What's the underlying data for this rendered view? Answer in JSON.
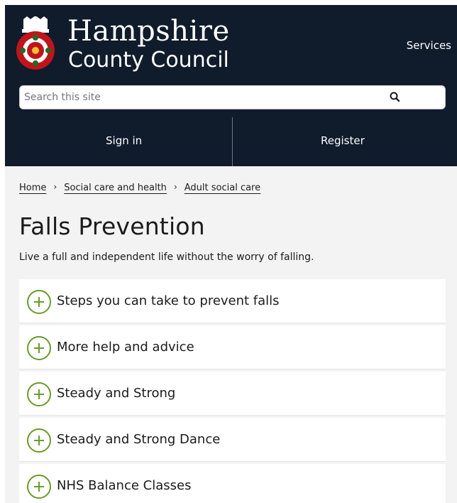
{
  "header": {
    "brand_line1": "Hampshire",
    "brand_line2": "County Council",
    "services_label": "Services",
    "background_color": "#101b2c"
  },
  "search": {
    "placeholder": "Search this site",
    "icon": "search-icon"
  },
  "auth": {
    "sign_in_label": "Sign in",
    "register_label": "Register"
  },
  "breadcrumb": [
    {
      "label": "Home"
    },
    {
      "label": "Social care and health"
    },
    {
      "label": "Adult social care"
    }
  ],
  "main": {
    "title": "Falls Prevention",
    "intro": "Live a full and independent life without the worry of falling."
  },
  "accordion": {
    "icon": "plus-circle-icon",
    "accent_color": "#6a9a2c",
    "items": [
      {
        "label": "Steps you can take to prevent falls"
      },
      {
        "label": "More help and advice"
      },
      {
        "label": "Steady and Strong"
      },
      {
        "label": "Steady and Strong Dance"
      },
      {
        "label": "NHS Balance Classes"
      }
    ]
  }
}
